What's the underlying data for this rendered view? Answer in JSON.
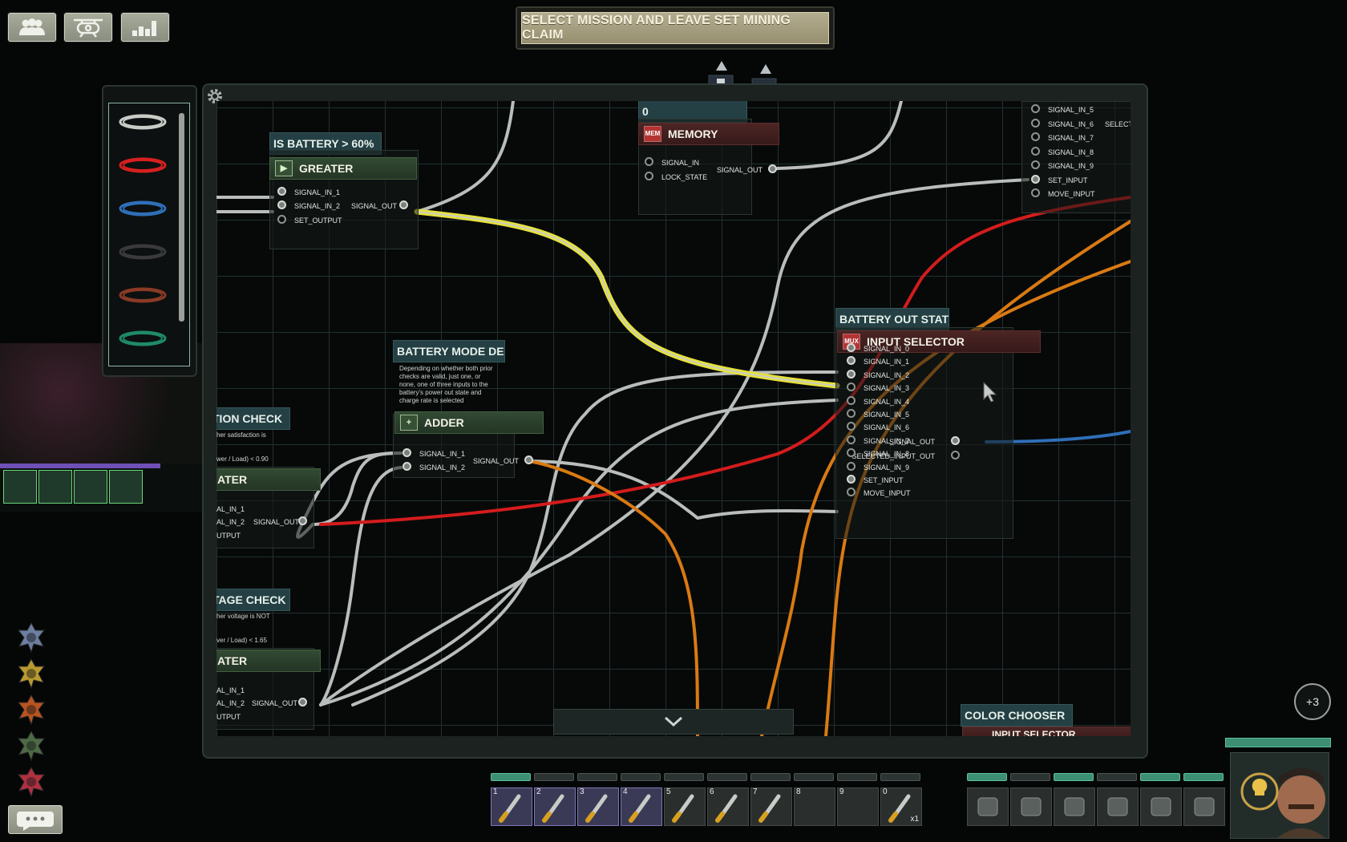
{
  "top_buttons": [
    {
      "icon": "crew-icon"
    },
    {
      "icon": "submarine-icon"
    },
    {
      "icon": "statistics-icon"
    }
  ],
  "mission_banner": "SELECT MISSION AND LEAVE SET MINING CLAIM",
  "wire_palette": {
    "colors": [
      "#c9cbc6",
      "#d62020",
      "#2f6fb8",
      "#2a2a2a",
      "#8a3a26",
      "#1f8a6a"
    ]
  },
  "board": {
    "components": {
      "greater_top": {
        "label": "IS BATTERY > 60%",
        "title": "GREATER",
        "inputs": [
          "SIGNAL_IN_1",
          "SIGNAL_IN_2",
          "SET_OUTPUT"
        ],
        "output": "SIGNAL_OUT"
      },
      "memory": {
        "label": "0",
        "title": "MEMORY",
        "icon": "MEM",
        "inputs": [
          "SIGNAL_IN",
          "LOCK_STATE"
        ],
        "output": "SIGNAL_OUT"
      },
      "input_selector_top": {
        "inputs": [
          "SIGNAL_IN_5",
          "SIGNAL_IN_6",
          "SIGNAL_IN_7",
          "SIGNAL_IN_8",
          "SIGNAL_IN_9",
          "SET_INPUT",
          "MOVE_INPUT"
        ],
        "output_partial": "SELECTE"
      },
      "adder": {
        "label": "BATTERY MODE DECI...",
        "description": "Depending on whether both prior checks are valid, just one, or none, one of three inputs to the battery's power out state and charge rate is selected",
        "title": "ADDER",
        "inputs": [
          "SIGNAL_IN_1",
          "SIGNAL_IN_2"
        ],
        "output": "SIGNAL_OUT"
      },
      "input_selector": {
        "label": "BATTERY OUT STATE",
        "title": "INPUT SELECTOR",
        "icon": "MUX",
        "inputs": [
          "SIGNAL_IN_0",
          "SIGNAL_IN_1",
          "SIGNAL_IN_2",
          "SIGNAL_IN_3",
          "SIGNAL_IN_4",
          "SIGNAL_IN_5",
          "SIGNAL_IN_6",
          "SIGNAL_IN_7",
          "SIGNAL_IN_8",
          "SIGNAL_IN_9",
          "SET_INPUT",
          "MOVE_INPUT"
        ],
        "outputs": [
          "SIGNAL_OUT",
          "SELECTED_INPUT_OUT"
        ]
      },
      "left_mid": {
        "label": "TION CHECK",
        "desc1": "her satisfaction is",
        "desc2": "wer / Load) < 0.90",
        "title": "ATER",
        "inputs": [
          "AL_IN_1",
          "AL_IN_2",
          "UTPUT"
        ],
        "output": "SIGNAL_OUT"
      },
      "left_bottom": {
        "label": "TAGE CHECK",
        "desc1": "her voltage is NOT",
        "desc2": "ver / Load) < 1.65",
        "title": "ATER",
        "inputs": [
          "AL_IN_1",
          "AL_IN_2",
          "UTPUT"
        ],
        "output": "SIGNAL_OUT"
      },
      "color_chooser": {
        "label": "COLOR CHOOSER",
        "title": "INPUT SELECTOR"
      }
    }
  },
  "hotbar": {
    "slots": [
      {
        "n": "1",
        "icon": "screwdriver-icon",
        "selected": true
      },
      {
        "n": "2",
        "icon": "wrench-icon",
        "selected": true
      },
      {
        "n": "3",
        "icon": "plasma-cutter-icon",
        "selected": true
      },
      {
        "n": "4",
        "icon": "screwdriver-icon",
        "selected": true
      },
      {
        "n": "5",
        "icon": "diving-mask-icon",
        "selected": false
      },
      {
        "n": "6",
        "icon": "flashlight-icon",
        "selected": false
      },
      {
        "n": "7",
        "icon": "welding-tool-icon",
        "selected": false
      },
      {
        "n": "8",
        "icon": "",
        "selected": false
      },
      {
        "n": "9",
        "icon": "",
        "selected": false
      },
      {
        "n": "0",
        "icon": "syringe-icon",
        "selected": false,
        "count": "x1"
      }
    ],
    "right_slots": [
      "id-card-icon",
      "helmet-icon",
      "vest-icon",
      "headset-icon",
      "bag-icon",
      "id-tag-icon"
    ]
  },
  "notifications": "+3",
  "skills": [
    "medical-icon",
    "electrical-icon",
    "fire-icon",
    "helm-icon",
    "weapons-icon"
  ]
}
